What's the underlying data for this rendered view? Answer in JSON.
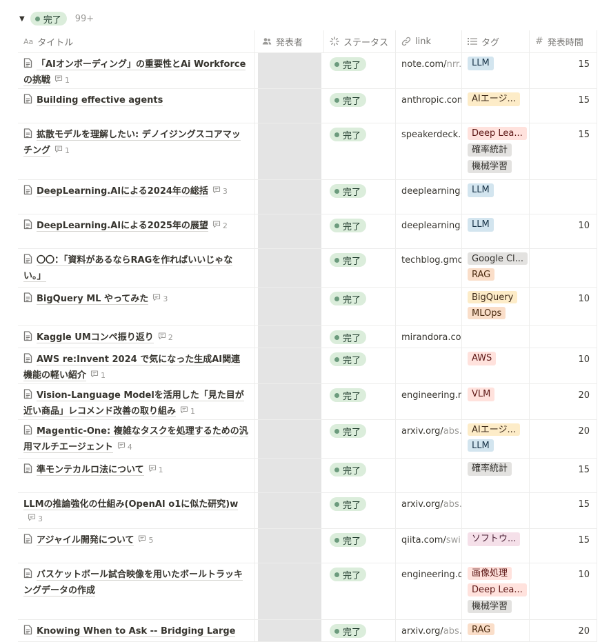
{
  "group": {
    "status_label": "完了",
    "count": "99+"
  },
  "columns": {
    "title": "タイトル",
    "presenter": "発表者",
    "status": "ステータス",
    "link": "link",
    "tags": "タグ",
    "time": "発表時間"
  },
  "tag_colors": {
    "blue": {
      "bg": "#d3e5ef",
      "fg": "#183347"
    },
    "yellow": {
      "bg": "#fdecc8",
      "fg": "#402c1b"
    },
    "red": {
      "bg": "#ffe2dd",
      "fg": "#5d1715"
    },
    "gray": {
      "bg": "#e3e2e0",
      "fg": "#32302c"
    },
    "orange": {
      "bg": "#fadec9",
      "fg": "#49290e"
    },
    "pink": {
      "bg": "#f5e0e9",
      "fg": "#4c2337"
    }
  },
  "rows": [
    {
      "title": "「AIオンボーディング」の重要性とAi Workforceの挑戦",
      "comments": "1",
      "doc_icon": true,
      "status": "完了",
      "link": "note.com/",
      "link_rest": "nrr...",
      "tags": [
        {
          "label": "LLM",
          "color": "blue"
        }
      ],
      "time": "15",
      "height": 52
    },
    {
      "title": "Building effective agents",
      "comments": "",
      "doc_icon": true,
      "status": "完了",
      "link": "anthropic.com",
      "link_rest": "",
      "tags": [
        {
          "label": "AIエージ...",
          "color": "yellow"
        }
      ],
      "time": "15",
      "height": 50
    },
    {
      "title": "拡散モデルを理解したい: デノイジングスコアマッチング",
      "comments": "1",
      "doc_icon": true,
      "status": "完了",
      "link": "speakerdeck.c",
      "link_rest": "",
      "tags": [
        {
          "label": "Deep Lea...",
          "color": "red"
        },
        {
          "label": "確率統計",
          "color": "gray"
        },
        {
          "label": "機械学習",
          "color": "gray"
        }
      ],
      "time": "15",
      "height": 82
    },
    {
      "title": "DeepLearning.AIによる2024年の総括",
      "comments": "3",
      "doc_icon": true,
      "status": "完了",
      "link": "deeplearning.a",
      "link_rest": "",
      "tags": [
        {
          "label": "LLM",
          "color": "blue"
        }
      ],
      "time": "",
      "height": 50
    },
    {
      "title": "DeepLearning.AIによる2025年の展望",
      "comments": "2",
      "doc_icon": true,
      "status": "完了",
      "link": "deeplearning.a",
      "link_rest": "",
      "tags": [
        {
          "label": "LLM",
          "color": "blue"
        }
      ],
      "time": "10",
      "height": 50
    },
    {
      "title": "〇〇：「資料があるならRAGを作ればいいじゃない。」",
      "comments": "",
      "doc_icon": true,
      "status": "完了",
      "link": "techblog.gmo-",
      "link_rest": "",
      "tags": [
        {
          "label": "Google Cl...",
          "color": "gray"
        },
        {
          "label": "RAG",
          "color": "orange"
        }
      ],
      "time": "",
      "height": 56
    },
    {
      "title": "BigQuery ML やってみた",
      "comments": "3",
      "doc_icon": true,
      "status": "完了",
      "link": "",
      "link_rest": "",
      "tags": [
        {
          "label": "BigQuery",
          "color": "yellow"
        },
        {
          "label": "MLOps",
          "color": "orange"
        }
      ],
      "time": "10",
      "height": 56
    },
    {
      "title": "Kaggle UMコンペ振り返り",
      "comments": "2",
      "doc_icon": true,
      "status": "完了",
      "link": "mirandora.com",
      "link_rest": "",
      "tags": [],
      "time": "",
      "height": 32
    },
    {
      "title": "AWS re:Invent 2024 で気になった生成AI関連機能の軽い紹介",
      "comments": "1",
      "doc_icon": true,
      "status": "完了",
      "link": "",
      "link_rest": "",
      "tags": [
        {
          "label": "AWS",
          "color": "red"
        }
      ],
      "time": "10",
      "height": 52
    },
    {
      "title": "Vision-Language Modelを活用した「見た目が近い商品」レコメンド改善の取り組み",
      "comments": "1",
      "doc_icon": true,
      "status": "完了",
      "link": "engineering.m",
      "link_rest": "",
      "tags": [
        {
          "label": "VLM",
          "color": "red"
        }
      ],
      "time": "20",
      "height": 52
    },
    {
      "title": "Magentic-One: 複雑なタスクを処理するための汎用マルチエージェント",
      "comments": "4",
      "doc_icon": true,
      "status": "完了",
      "link": "arxiv.org/",
      "link_rest": "abs...",
      "tags": [
        {
          "label": "AIエージ...",
          "color": "yellow"
        },
        {
          "label": "LLM",
          "color": "blue"
        }
      ],
      "time": "20",
      "height": 56
    },
    {
      "title": "準モンテカルロ法について",
      "comments": "1",
      "doc_icon": true,
      "status": "完了",
      "link": "",
      "link_rest": "",
      "tags": [
        {
          "label": "確率統計",
          "color": "gray"
        }
      ],
      "time": "15",
      "height": 50
    },
    {
      "title": "LLMの推論強化の仕組み(OpenAI o1に似た研究)w",
      "comments": "3",
      "doc_icon": false,
      "status": "完了",
      "link": "arxiv.org/",
      "link_rest": "abs...",
      "tags": [],
      "time": "15",
      "height": 52
    },
    {
      "title": "アジャイル開発について",
      "comments": "5",
      "doc_icon": true,
      "status": "完了",
      "link": "qiita.com/",
      "link_rest": "swi...",
      "tags": [
        {
          "label": "ソフトウ...",
          "color": "pink"
        }
      ],
      "time": "15",
      "height": 50
    },
    {
      "title": "バスケットボール試合映像を用いたボールトラッキングデータの作成",
      "comments": "",
      "doc_icon": true,
      "status": "完了",
      "link": "engineering.de",
      "link_rest": "",
      "tags": [
        {
          "label": "画像処理",
          "color": "red"
        },
        {
          "label": "Deep Lea...",
          "color": "red"
        },
        {
          "label": "機械学習",
          "color": "gray"
        }
      ],
      "time": "10",
      "height": 82
    },
    {
      "title": "Knowing When to Ask -- Bridging Large",
      "comments": "",
      "doc_icon": true,
      "status": "完了",
      "link": "arxiv.org/",
      "link_rest": "abs...",
      "tags": [
        {
          "label": "RAG",
          "color": "orange"
        }
      ],
      "time": "20",
      "height": 32
    }
  ]
}
